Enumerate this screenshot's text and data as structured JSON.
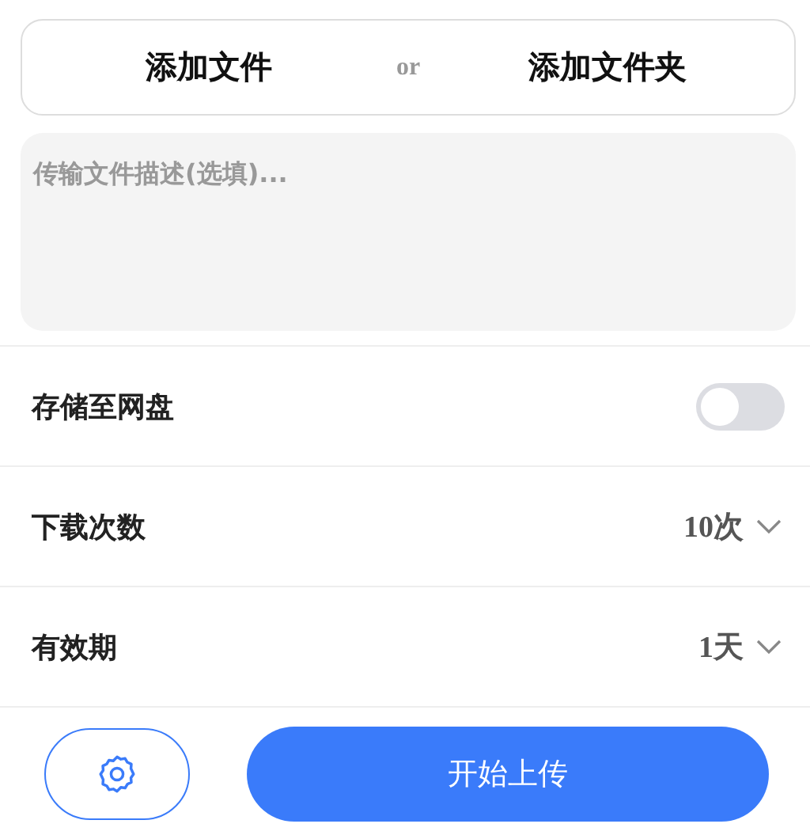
{
  "add_bar": {
    "add_files": "添加文件",
    "separator": "or",
    "add_folder": "添加文件夹"
  },
  "description": {
    "placeholder": "传输文件描述(选填)..."
  },
  "settings": [
    {
      "kind": "toggle",
      "label": "存储至网盘",
      "on": false
    },
    {
      "kind": "select",
      "label": "下载次数",
      "value": "10次"
    },
    {
      "kind": "select",
      "label": "有效期",
      "value": "1天"
    }
  ],
  "start_button": "开始上传"
}
